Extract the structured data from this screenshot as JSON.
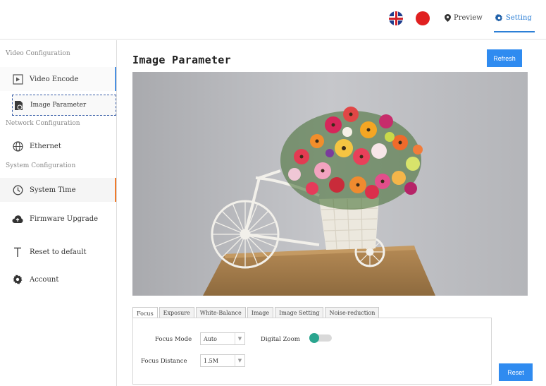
{
  "header": {
    "flags": [
      "uk-flag",
      "china-flag"
    ],
    "nav": {
      "preview": "Preview",
      "setting": "Setting"
    },
    "accent_color": "#2c7fd6"
  },
  "sidebar": {
    "sections": {
      "video": "Video Configuration",
      "network": "Network Configuration",
      "system": "System Configuration"
    },
    "items": [
      {
        "label": "Video Encode",
        "icon": "video-icon"
      },
      {
        "label": "Image Parameter",
        "icon": "camera-icon"
      },
      {
        "label": "Ethernet",
        "icon": "globe-icon"
      },
      {
        "label": "System Time",
        "icon": "clock-icon"
      },
      {
        "label": "Firmware Upgrade",
        "icon": "cloud-upload-icon"
      },
      {
        "label": "Reset to default",
        "icon": "reset-icon"
      },
      {
        "label": "Account",
        "icon": "gear-icon"
      }
    ]
  },
  "main": {
    "title": "Image Parameter",
    "refresh_label": "Refresh",
    "tabs": [
      "Focus",
      "Exposure",
      "White-Balance",
      "Image",
      "Image Setting",
      "Noise-reduction"
    ],
    "active_tab": "Focus",
    "focus": {
      "focus_mode_label": "Focus Mode",
      "focus_mode_value": "Auto",
      "digital_zoom_label": "Digital Zoom",
      "digital_zoom_on": true,
      "focus_distance_label": "Focus Distance",
      "focus_distance_value": "1.5M"
    },
    "reset_label": "Reset",
    "button_color": "#2f8bf0"
  }
}
